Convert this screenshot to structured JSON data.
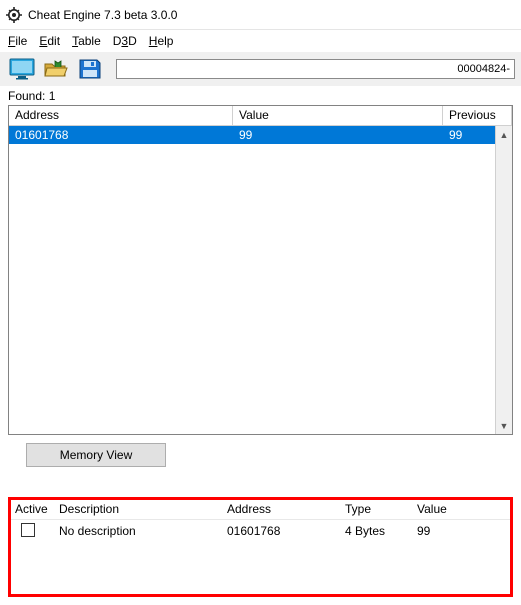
{
  "window": {
    "title": "Cheat Engine 7.3 beta 3.0.0"
  },
  "menu": {
    "file": "File",
    "edit": "Edit",
    "table": "Table",
    "d3d": "D3D",
    "help": "Help"
  },
  "toolbar": {
    "progress_text": "00004824-"
  },
  "results": {
    "found_label": "Found: 1",
    "headers": {
      "address": "Address",
      "value": "Value",
      "previous": "Previous"
    },
    "rows": [
      {
        "address": "01601768",
        "value": "99",
        "previous": "99",
        "selected": true
      }
    ]
  },
  "buttons": {
    "memory_view": "Memory View"
  },
  "addresslist": {
    "headers": {
      "active": "Active",
      "description": "Description",
      "address": "Address",
      "type": "Type",
      "value": "Value"
    },
    "rows": [
      {
        "active": false,
        "description": "No description",
        "address": "01601768",
        "type": "4 Bytes",
        "value": "99"
      }
    ]
  }
}
